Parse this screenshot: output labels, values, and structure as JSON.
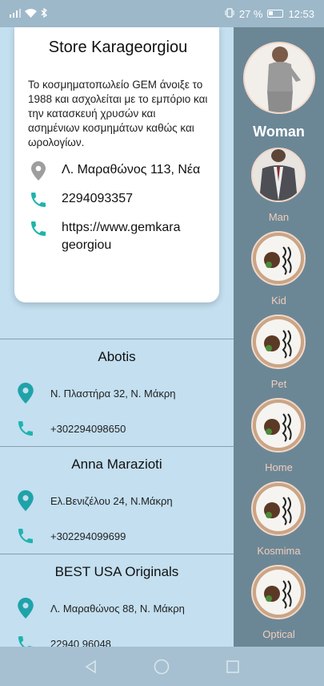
{
  "status": {
    "battery": "27 %",
    "time": "12:53"
  },
  "card": {
    "title": "Store Karageorgiou",
    "description": "Το κοσμηματοπωλείο GEM άνοιξε το 1988 και ασχολείται με το εμπόριο και την κατασκευή χρυσών και ασημένιων κοσμημάτων καθώς και ωρολογίων.",
    "address": "Λ. Μαραθώνος 113, Νέα",
    "phone": "2294093357",
    "website": "https://www.gemkarageorgiou"
  },
  "stores": [
    {
      "name": "Abotis",
      "address": "Ν. Πλαστήρα 32, Ν. Μάκρη",
      "phone": "+302294098650"
    },
    {
      "name": "Anna Marazioti",
      "address": "Ελ.Βενιζέλου 24, Ν.Μάκρη",
      "phone": "+302294099699"
    },
    {
      "name": "BEST USA Originals",
      "address": "Λ. Μαραθώνος 88, Ν. Μάκρη",
      "phone": "22940 96048"
    }
  ],
  "categories": [
    {
      "label": "Woman",
      "icon": "woman-photo",
      "selected": true
    },
    {
      "label": "Man",
      "icon": "man-photo"
    },
    {
      "label": "Kid",
      "icon": "food-plate-photo"
    },
    {
      "label": "Pet",
      "icon": "food-plate-photo"
    },
    {
      "label": "Home",
      "icon": "food-plate-photo"
    },
    {
      "label": "Kosmima",
      "icon": "food-plate-photo"
    },
    {
      "label": "Optical",
      "icon": "food-plate-photo"
    }
  ],
  "colors": {
    "accent_teal": "#1fb3ae",
    "location_gray": "#9e9e9e",
    "rail_bg": "#6b8796",
    "label_peach": "#f3cdbb"
  }
}
